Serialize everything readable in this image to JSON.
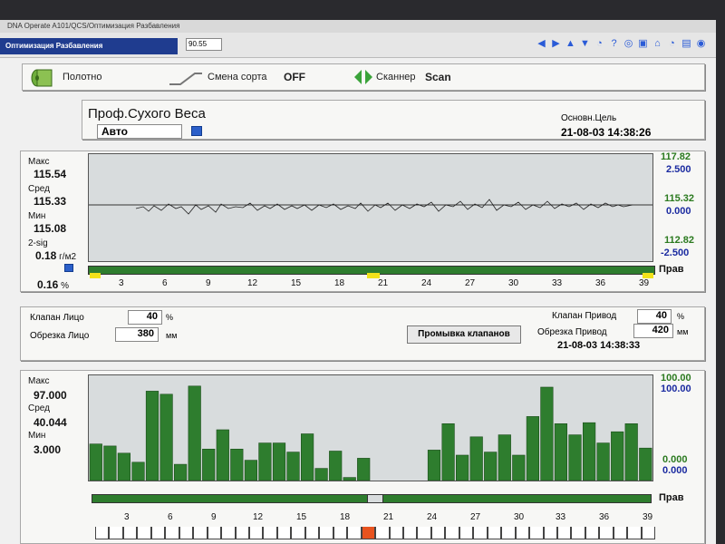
{
  "window": {
    "title": "DNA Operate A101/QCS/Оптимизация Разбавления"
  },
  "toolbar": {
    "title": "Оптимизация Разбавления",
    "field_value": "90.55"
  },
  "status_row": {
    "web_label": "Полотно",
    "grade_change_label": "Смена сорта",
    "grade_change_value": "OFF",
    "scanner_label": "Сканнер",
    "scanner_value": "Scan"
  },
  "header": {
    "title": "Проф.Сухого Веса",
    "mode": "Авто",
    "target_label": "Основн.Цель",
    "target_time": "21-08-03 14:38:26"
  },
  "profile_chart": {
    "stats": {
      "max_label": "Макс",
      "max_value": "115.54",
      "avg_label": "Сред",
      "avg_value": "115.33",
      "min_label": "Мин",
      "min_value": "115.08",
      "sig_label": "2-sig",
      "sig_value": "0.18",
      "sig_unit": "г/м2",
      "pct_value": "0.16",
      "pct_unit": "%"
    },
    "right_top_green": "117.82",
    "right_top_blue": "2.500",
    "right_mid_green": "115.32",
    "right_mid_blue": "0.000",
    "right_bot_green": "112.82",
    "right_bot_blue": "-2.500",
    "side_label": "Прав"
  },
  "valves": {
    "face_valve_label": "Клапан Лицо",
    "face_valve_value": "40",
    "face_valve_unit": "%",
    "face_trim_label": "Обрезка Лицо",
    "face_trim_value": "380",
    "face_trim_unit": "мм",
    "wash_button": "Промывка клапанов",
    "drive_valve_label": "Клапан Привод",
    "drive_valve_value": "40",
    "drive_valve_unit": "%",
    "drive_trim_label": "Обрезка Привод",
    "drive_trim_value": "420",
    "drive_trim_unit": "мм",
    "time": "21-08-03 14:38:33"
  },
  "actuator_chart": {
    "stats": {
      "max_label": "Макс",
      "max_value": "97.000",
      "avg_label": "Сред",
      "avg_value": "40.044",
      "min_label": "Мин",
      "min_value": "3.000"
    },
    "right_top_green": "100.00",
    "right_top_blue": "100.00",
    "right_bot_green": "0.000",
    "right_bot_blue": "0.000",
    "side_label": "Прав"
  },
  "ticks": [
    "3",
    "6",
    "9",
    "12",
    "15",
    "18",
    "21",
    "24",
    "27",
    "30",
    "33",
    "36",
    "39"
  ],
  "chart_data": {
    "type": "bar",
    "title": "",
    "xlabel": "",
    "ylabel": "",
    "ylim": [
      0,
      100
    ],
    "categories": [
      "1",
      "2",
      "3",
      "4",
      "5",
      "6",
      "7",
      "8",
      "9",
      "10",
      "11",
      "12",
      "13",
      "14",
      "15",
      "16",
      "17",
      "18",
      "19",
      "20",
      "21",
      "22",
      "23",
      "24",
      "25",
      "26",
      "27",
      "28",
      "29",
      "30",
      "31",
      "32",
      "33",
      "34",
      "35",
      "36",
      "37",
      "38",
      "39",
      "40"
    ],
    "values": [
      36,
      34,
      27,
      18,
      88,
      85,
      16,
      93,
      31,
      50,
      31,
      20,
      37,
      37,
      28,
      46,
      12,
      29,
      3,
      22,
      0,
      0,
      0,
      0,
      30,
      56,
      25,
      43,
      28,
      45,
      25,
      63,
      92,
      56,
      45,
      57,
      37,
      48,
      56,
      32
    ],
    "highlight_index": 19
  },
  "colors": {
    "bar": "#2e7d2e",
    "plot_bg": "#d8dcdd",
    "accent_orange": "#e8531f",
    "title_bar": "#1f3c8f"
  }
}
